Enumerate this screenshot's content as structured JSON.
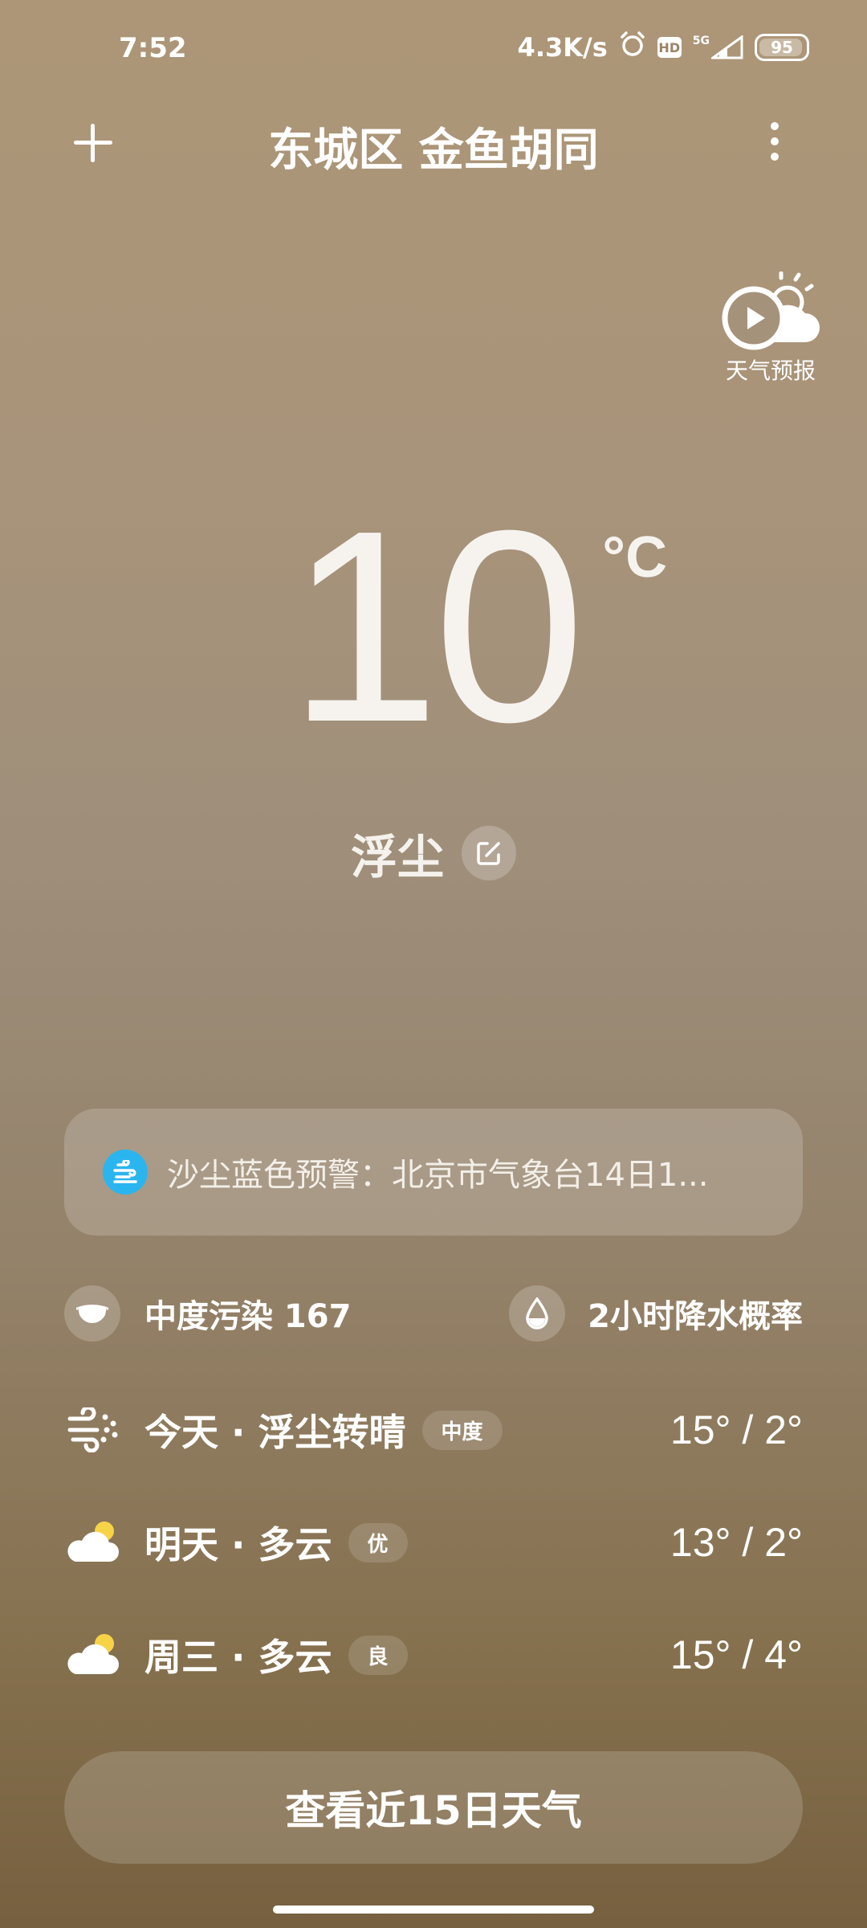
{
  "status_bar": {
    "time": "7:52",
    "net_speed": "4.3K/s",
    "hd": "HD",
    "network": "5G",
    "battery": "95",
    "battery_level": 0.95
  },
  "header": {
    "location": "东城区 金鱼胡同",
    "add_icon": "plus-icon",
    "more_icon": "more-vertical-icon"
  },
  "forecast_video": {
    "label": "天气预报",
    "icon": "play-cloud-sun-icon"
  },
  "current": {
    "temperature": "10",
    "unit": "°C",
    "condition": "浮尘",
    "edit_icon": "edit-icon"
  },
  "alert": {
    "icon": "dust-warning-icon",
    "text": "沙尘蓝色预警：北京市气象台14日1..."
  },
  "air": {
    "aqi_text": "中度污染 167",
    "aqi_icon": "mask-icon",
    "rain_text": "2小时降水概率",
    "rain_icon": "raindrop-icon"
  },
  "forecast": [
    {
      "label": "今天 · 浮尘转晴",
      "badge": "中度",
      "range": "15° / 2°",
      "icon": "dust-wind-icon"
    },
    {
      "label": "明天 · 多云",
      "badge": "优",
      "range": "13° / 2°",
      "icon": "cloudy-sun-icon"
    },
    {
      "label": "周三 · 多云",
      "badge": "良",
      "range": "15° / 4°",
      "icon": "cloudy-sun-icon"
    }
  ],
  "bottom_button": "查看近15日天气",
  "colors": {
    "alert_icon_bg": "#2ab5ef",
    "sun_yellow": "#f7d348"
  }
}
